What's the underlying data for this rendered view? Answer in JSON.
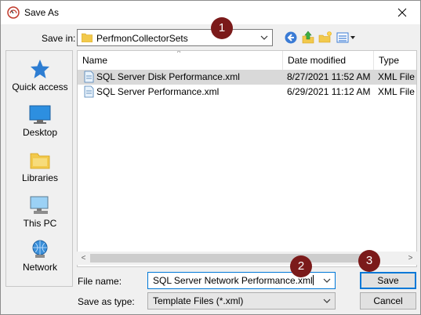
{
  "window": {
    "title": "Save As"
  },
  "save_in": {
    "label": "Save in:",
    "value": "PerfmonCollectorSets"
  },
  "nav": {
    "items": [
      {
        "label": "Quick access",
        "icon": "star-icon"
      },
      {
        "label": "Desktop",
        "icon": "desktop-icon"
      },
      {
        "label": "Libraries",
        "icon": "libraries-icon"
      },
      {
        "label": "This PC",
        "icon": "computer-icon"
      },
      {
        "label": "Network",
        "icon": "network-icon"
      }
    ]
  },
  "file_list": {
    "columns": [
      "Name",
      "Date modified",
      "Type"
    ],
    "rows": [
      {
        "name": "SQL Server Disk Performance.xml",
        "date": "8/27/2021 11:52 AM",
        "type": "XML File",
        "selected": true
      },
      {
        "name": "SQL Server Performance.xml",
        "date": "6/29/2021 11:12 AM",
        "type": "XML File",
        "selected": false
      }
    ]
  },
  "file_name": {
    "label": "File name:",
    "value": "SQL Server Network Performance.xml"
  },
  "save_as_type": {
    "label": "Save as type:",
    "value": "Template Files (*.xml)"
  },
  "buttons": {
    "save": "Save",
    "cancel": "Cancel"
  },
  "badges": [
    "1",
    "2",
    "3"
  ],
  "colors": {
    "badge": "#7b1a1a",
    "focus": "#0078d7",
    "selection": "#d9d9d9"
  }
}
